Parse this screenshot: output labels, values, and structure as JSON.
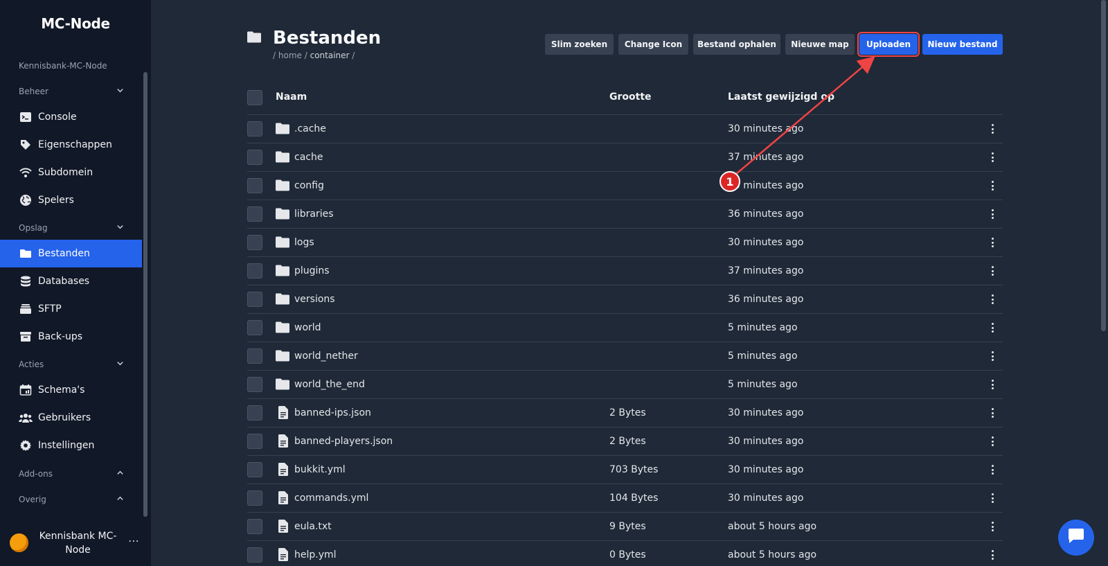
{
  "app": {
    "brand": "MC-Node",
    "server_name": "Kennisbank-MC-Node"
  },
  "sidebar": {
    "sections": [
      {
        "label": "Beheer",
        "expanded": true
      },
      {
        "label": "Opslag",
        "expanded": true
      },
      {
        "label": "Acties",
        "expanded": true
      },
      {
        "label": "Add-ons",
        "expanded": false
      },
      {
        "label": "Overig",
        "expanded": false
      }
    ],
    "items": [
      {
        "label": "Console",
        "icon": "terminal-icon"
      },
      {
        "label": "Eigenschappen",
        "icon": "tag-icon"
      },
      {
        "label": "Subdomein",
        "icon": "wifi-icon"
      },
      {
        "label": "Spelers",
        "icon": "globe-icon"
      },
      {
        "label": "Bestanden",
        "icon": "folder-icon",
        "active": true
      },
      {
        "label": "Databases",
        "icon": "database-icon"
      },
      {
        "label": "SFTP",
        "icon": "storage-icon"
      },
      {
        "label": "Back-ups",
        "icon": "archive-icon"
      },
      {
        "label": "Schema's",
        "icon": "calendar-icon"
      },
      {
        "label": "Gebruikers",
        "icon": "users-icon"
      },
      {
        "label": "Instellingen",
        "icon": "gear-icon"
      }
    ],
    "user": {
      "name": "Kennisbank MC-Node",
      "menu": "⋯"
    }
  },
  "page": {
    "title": "Bestanden",
    "breadcrumb": {
      "sep1": "/",
      "home": "home",
      "sep2": "/",
      "current": "container",
      "sep3": "/"
    }
  },
  "toolbar": {
    "smart_search": "Slim zoeken",
    "change_icon": "Change Icon",
    "fetch_file": "Bestand ophalen",
    "new_folder": "Nieuwe map",
    "upload": "Uploaden",
    "new_file": "Nieuw bestand"
  },
  "table": {
    "headers": {
      "name": "Naam",
      "size": "Grootte",
      "modified": "Laatst gewijzigd op"
    },
    "rows": [
      {
        "type": "folder",
        "name": ".cache",
        "size": "",
        "modified": "30 minutes ago"
      },
      {
        "type": "folder",
        "name": "cache",
        "size": "",
        "modified": "37 minutes ago"
      },
      {
        "type": "folder",
        "name": "config",
        "size": "",
        "modified": "30 minutes ago"
      },
      {
        "type": "folder",
        "name": "libraries",
        "size": "",
        "modified": "36 minutes ago"
      },
      {
        "type": "folder",
        "name": "logs",
        "size": "",
        "modified": "30 minutes ago"
      },
      {
        "type": "folder",
        "name": "plugins",
        "size": "",
        "modified": "37 minutes ago"
      },
      {
        "type": "folder",
        "name": "versions",
        "size": "",
        "modified": "36 minutes ago"
      },
      {
        "type": "folder",
        "name": "world",
        "size": "",
        "modified": "5 minutes ago"
      },
      {
        "type": "folder",
        "name": "world_nether",
        "size": "",
        "modified": "5 minutes ago"
      },
      {
        "type": "folder",
        "name": "world_the_end",
        "size": "",
        "modified": "5 minutes ago"
      },
      {
        "type": "file",
        "name": "banned-ips.json",
        "size": "2 Bytes",
        "modified": "30 minutes ago"
      },
      {
        "type": "file",
        "name": "banned-players.json",
        "size": "2 Bytes",
        "modified": "30 minutes ago"
      },
      {
        "type": "file",
        "name": "bukkit.yml",
        "size": "703 Bytes",
        "modified": "30 minutes ago"
      },
      {
        "type": "file",
        "name": "commands.yml",
        "size": "104 Bytes",
        "modified": "30 minutes ago"
      },
      {
        "type": "file",
        "name": "eula.txt",
        "size": "9 Bytes",
        "modified": "about 5 hours ago"
      },
      {
        "type": "file",
        "name": "help.yml",
        "size": "0 Bytes",
        "modified": "about 5 hours ago"
      }
    ]
  },
  "annotation": {
    "step": "1"
  },
  "colors": {
    "accent": "#2563eb",
    "annotation": "#ef4444",
    "sidebar_bg": "#111827",
    "main_bg": "#1f2937"
  }
}
